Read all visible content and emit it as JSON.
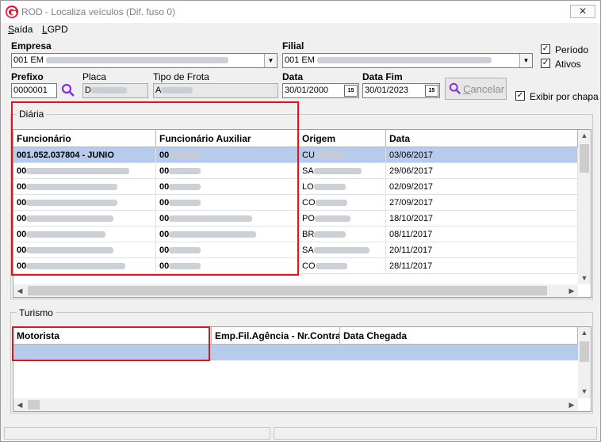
{
  "window": {
    "title": "ROD - Localiza veículos (Dif. fuso 0)",
    "close_glyph": "✕"
  },
  "menu": [
    {
      "access": "S",
      "rest": "aída"
    },
    {
      "access": "L",
      "rest": "GPD"
    }
  ],
  "filters": {
    "empresa_label": "Empresa",
    "empresa_value": "001 EM",
    "filial_label": "Filial",
    "filial_value": "001 EM",
    "prefixo_label": "Prefixo",
    "prefixo_value": "0000001",
    "placa_label": "Placa",
    "placa_value": "D",
    "tipo_frota_label": "Tipo de Frota",
    "tipo_frota_value": "A",
    "data_label": "Data",
    "data_value": "30/01/2000",
    "data_fim_label": "Data Fim",
    "data_fim_value": "30/01/2023",
    "calendar_glyph": "15",
    "periodo_label": "Período",
    "ativos_label": "Ativos",
    "exibir_label": "Exibir por chapa",
    "check_glyph": "✓",
    "cancel_access": "C",
    "cancel_rest": "ancelar",
    "dropdown_glyph": "▼"
  },
  "diaria": {
    "title": "Diária",
    "columns": [
      "Funcionário",
      "Funcionário Auxiliar",
      "Origem",
      "Data"
    ],
    "rows": [
      {
        "func": "001.052.037804 - JUNIO",
        "aux": "00",
        "origem": "CU",
        "data": "03/06/2017"
      },
      {
        "func": "00",
        "aux": "00",
        "origem": "SA",
        "data": "29/06/2017"
      },
      {
        "func": "00",
        "aux": "00",
        "origem": "LO",
        "data": "02/09/2017"
      },
      {
        "func": "00",
        "aux": "00",
        "origem": "CO",
        "data": "27/09/2017"
      },
      {
        "func": "00",
        "aux": "00",
        "origem": "PO",
        "data": "18/10/2017"
      },
      {
        "func": "00",
        "aux": "00",
        "origem": "BR",
        "data": "08/11/2017"
      },
      {
        "func": "00",
        "aux": "00",
        "origem": "SA",
        "data": "20/11/2017"
      },
      {
        "func": "00",
        "aux": "00",
        "origem": "CO",
        "data": "28/11/2017"
      }
    ]
  },
  "turismo": {
    "title": "Turismo",
    "columns": [
      "Motorista",
      "Emp.Fil.Agência - Nr.Contra...",
      "Data Chegada"
    ]
  },
  "scroll": {
    "up": "▲",
    "down": "▼",
    "left": "◀",
    "right": "▶"
  },
  "colors": {
    "selection": "#b7cbec",
    "annotation": "#e3131b",
    "logo": "#e0182d",
    "search": "#8a2be2"
  }
}
